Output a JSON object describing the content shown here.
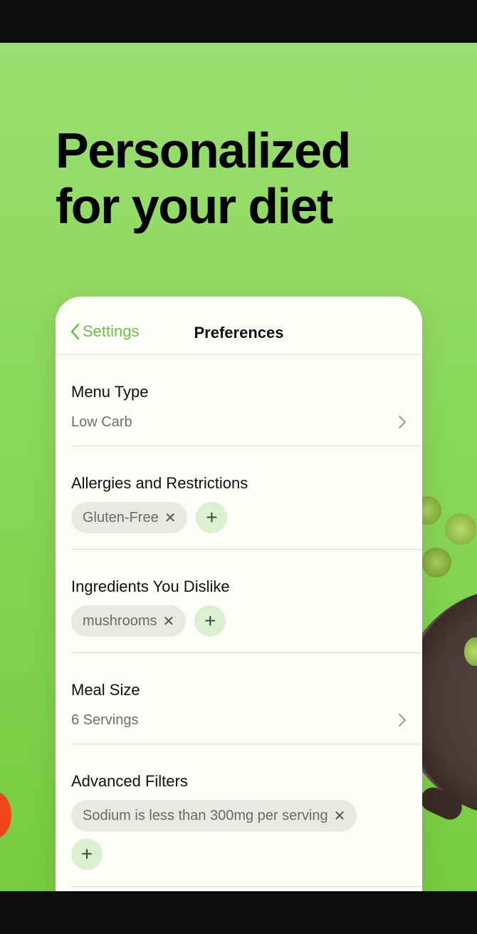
{
  "headline": [
    "Personalized",
    "for your diet"
  ],
  "nav": {
    "back_label": "Settings",
    "title": "Preferences"
  },
  "menu_type": {
    "title": "Menu Type",
    "value": "Low Carb"
  },
  "allergies": {
    "title": "Allergies and Restrictions",
    "chips": [
      "Gluten-Free"
    ]
  },
  "dislikes": {
    "title": "Ingredients You Dislike",
    "chips": [
      "mushrooms"
    ]
  },
  "meal_size": {
    "title": "Meal Size",
    "value": "6 Servings"
  },
  "advanced": {
    "title": "Advanced Filters",
    "chips": [
      "Sodium is less than 300mg per serving"
    ]
  },
  "colors": {
    "accent": "#6cc04a",
    "background": "#8ad75a",
    "chip_bg": "#e8e8e4",
    "add_bg": "#dbf0cf"
  }
}
